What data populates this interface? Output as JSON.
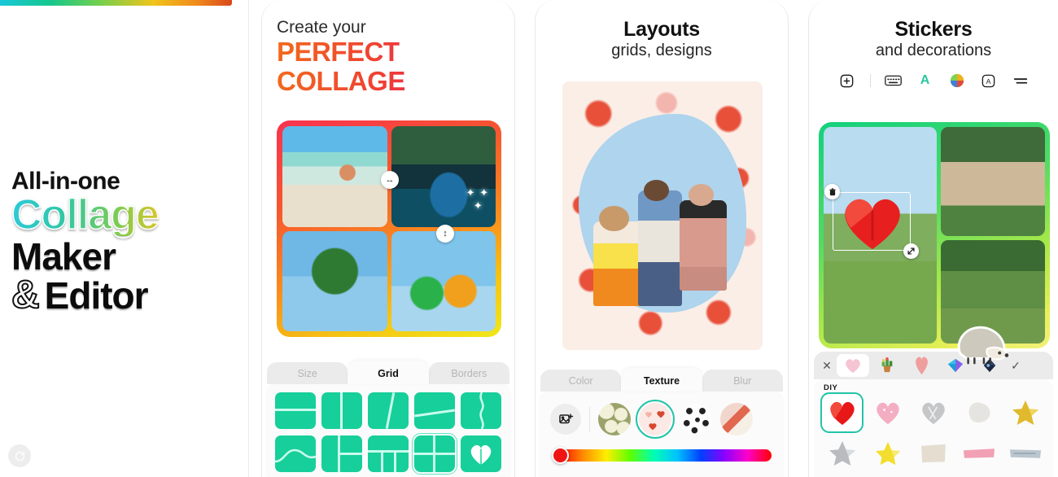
{
  "hero": {
    "line1": "All-in-one",
    "line2": "Collage",
    "line3": "Maker",
    "amp": "&",
    "line4": "Editor",
    "refresh_icon": "refresh-icon",
    "gradient_bar_colors": [
      "#18c8d8",
      "#16c78c",
      "#6fcf4f",
      "#f0c41b",
      "#f08a1b",
      "#d8471b"
    ]
  },
  "panel2": {
    "heading_small": "Create your",
    "heading_big_line1": "PERFECT",
    "heading_big_line2": "COLLAGE",
    "heading_gradient": [
      "#f26a1b",
      "#e01a74"
    ],
    "collage": {
      "border_gradient": [
        "#f8324f",
        "#f0e81a"
      ],
      "cells": [
        "beach-woman-photo",
        "ocean-cave-photo",
        "palm-tree-photo",
        "cocktail-drinks-photo"
      ],
      "handles": [
        "horizontal-resize-handle",
        "vertical-resize-handle"
      ],
      "sparkle_glyph": "✦"
    },
    "tabs": [
      {
        "label": "Size",
        "active": false
      },
      {
        "label": "Grid",
        "active": true
      },
      {
        "label": "Borders",
        "active": false
      }
    ],
    "grid_color": "#17cf9a",
    "grid_row1": [
      "two-rows",
      "two-columns",
      "diagonal-split",
      "slanted-split",
      "wavy-vertical-split"
    ],
    "grid_row2": [
      "curved-split",
      "left-column-two-right",
      "top-three-bottom",
      "four-square",
      "heart-split"
    ],
    "grid_selected_index": 8
  },
  "panel3": {
    "title": "Layouts",
    "subtitle": "grids, designs",
    "canvas": {
      "background_pattern": "hearts-pattern",
      "blob_color": "#aed4ee",
      "content": "three-people-jumping-photo"
    },
    "tabs": [
      {
        "label": "Color",
        "active": false
      },
      {
        "label": "Texture",
        "active": true
      },
      {
        "label": "Blur",
        "active": false
      }
    ],
    "add_image_icon": "add-image-icon",
    "textures": [
      "olive-floral-texture",
      "hearts-texture",
      "polka-dot-texture",
      "abstract-texture"
    ],
    "texture_selected_index": 1,
    "hue_slider": {
      "knob_color": "#f01414",
      "position_percent": 2
    }
  },
  "panel4": {
    "title": "Stickers",
    "subtitle": "and decorations",
    "toolbar": [
      {
        "icon": "add-square-icon",
        "label": "+"
      },
      {
        "icon": "separator",
        "label": ""
      },
      {
        "icon": "keyboard-icon",
        "label": ""
      },
      {
        "icon": "text-a-icon",
        "label": "A"
      },
      {
        "icon": "color-wheel-icon",
        "label": ""
      },
      {
        "icon": "font-box-icon",
        "label": "A"
      },
      {
        "icon": "menu-lines-icon",
        "label": ""
      }
    ],
    "collage": {
      "border_gradient": [
        "#13d07e",
        "#f2f07a"
      ],
      "cells": [
        "couple-in-field-photo",
        "family-tossing-baby-photo",
        "kids-wheelbarrow-photo"
      ],
      "selected_sticker": "red-heart-sticker",
      "delete_icon": "trash-icon",
      "resize_icon": "resize-handle-icon",
      "floating_sticker": "hedgehog-sticker"
    },
    "category_strip": {
      "close_icon": "close-icon",
      "confirm_icon": "check-icon",
      "categories": [
        "pink-heart",
        "cactus-pot",
        "pink-heart-tall",
        "blue-diamond",
        "dark-gem"
      ],
      "selected_index": 0
    },
    "section_label": "DIY",
    "stickers_row1": [
      "red-heart",
      "pink-glitter-heart",
      "silver-glitter-heart",
      "white-blob",
      "gold-glitter-star"
    ],
    "stickers_row2": [
      "silver-glitter-star",
      "yellow-star",
      "beige-square",
      "pink-tape",
      "blue-tape"
    ],
    "sticker_selected_index": 0
  }
}
